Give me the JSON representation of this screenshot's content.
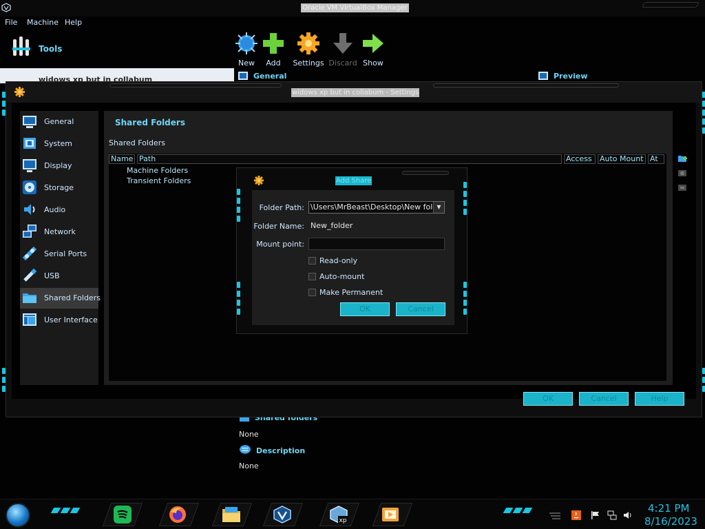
{
  "main_window": {
    "title": "Oracle VM VirtualBox Manager",
    "menu": [
      "File",
      "Machine",
      "Help"
    ],
    "tools_label": "Tools",
    "vm_name": "widows xp but in collabum",
    "toolbar": {
      "new": "New",
      "add": "Add",
      "settings": "Settings",
      "discard": "Discard",
      "show": "Show"
    },
    "details": {
      "general_header": "General",
      "preview_header": "Preview",
      "shared_folders_header": "Shared folders",
      "shared_folders_value": "None",
      "description_header": "Description",
      "description_value": "None"
    }
  },
  "settings_dialog": {
    "title": "widows xp but in collabum - Settings",
    "sidebar": [
      {
        "label": "General",
        "icon": "general-icon"
      },
      {
        "label": "System",
        "icon": "system-icon"
      },
      {
        "label": "Display",
        "icon": "display-icon"
      },
      {
        "label": "Storage",
        "icon": "storage-icon"
      },
      {
        "label": "Audio",
        "icon": "audio-icon"
      },
      {
        "label": "Network",
        "icon": "network-icon"
      },
      {
        "label": "Serial Ports",
        "icon": "serial-ports-icon"
      },
      {
        "label": "USB",
        "icon": "usb-icon"
      },
      {
        "label": "Shared Folders",
        "icon": "shared-folders-icon"
      },
      {
        "label": "User Interface",
        "icon": "user-interface-icon"
      }
    ],
    "selected_page": "Shared Folders",
    "page_heading": "Shared Folders",
    "section_label": "Shared Folders",
    "table_columns": [
      "Name",
      "Path",
      "Access",
      "Auto Mount",
      "At"
    ],
    "tree_rows": [
      "Machine Folders",
      "Transient Folders"
    ],
    "buttons": {
      "ok": "OK",
      "cancel": "Cancel",
      "help": "Help"
    }
  },
  "add_share_dialog": {
    "title": "Add Share",
    "folder_path_label": "Folder Path:",
    "folder_path_value": "\\Users\\MrBeast\\Desktop\\New folder",
    "folder_name_label": "Folder Name:",
    "folder_name_value": "New_folder",
    "mount_point_label": "Mount point:",
    "mount_point_value": "",
    "checkboxes": [
      {
        "label": "Read-only",
        "checked": false
      },
      {
        "label": "Auto-mount",
        "checked": false
      },
      {
        "label": "Make Permanent",
        "checked": false
      }
    ],
    "ok_label": "OK",
    "cancel_label": "Cancel"
  },
  "taskbar": {
    "pinned": [
      "spotify-icon",
      "firefox-icon",
      "file-explorer-icon",
      "virtualbox-icon",
      "vm-xp-icon",
      "media-player-icon"
    ],
    "clock_time": "4:21 PM",
    "clock_date": "8/16/2023"
  },
  "colors": {
    "accent": "#1ec1e0",
    "heading": "#6dd6f5",
    "button_bg": "#1ab3c9"
  }
}
